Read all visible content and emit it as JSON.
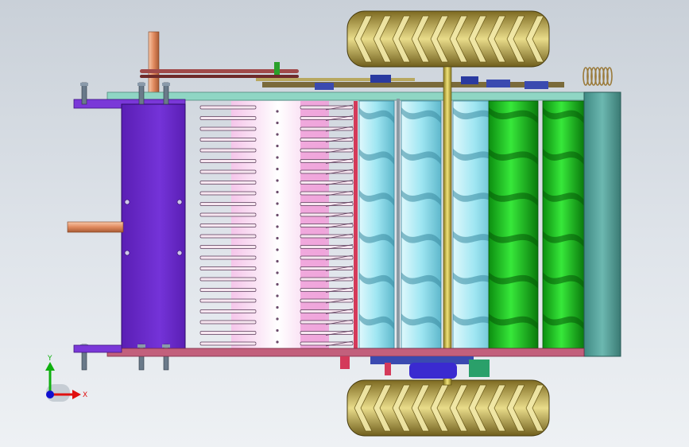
{
  "viewport": {
    "background_top": "#c9d0d8",
    "background_bottom": "#eef1f4"
  },
  "triad": {
    "y_label": "Y",
    "x_label": "X",
    "x_color": "#e01010",
    "y_color": "#10b010",
    "z_color": "#1010d0"
  },
  "colors": {
    "frame_purple": "#6a28c8",
    "top_bar": "#8fd6c4",
    "pink_bar": "#c2607c",
    "tooth": "#f7e6f0",
    "comb_pink": "#ef9fd8",
    "auger_blue": "#9fe6f2",
    "auger_green": "#19c21a",
    "end_plate": "#4e9a94",
    "tire": "#c7b34f",
    "shaft_gold": "#c7b84a",
    "rod_copper": "#e08a5e"
  },
  "parts": {
    "tooth_count": 23,
    "blue_auger_turns": 6,
    "green_auger_turns": 6
  }
}
